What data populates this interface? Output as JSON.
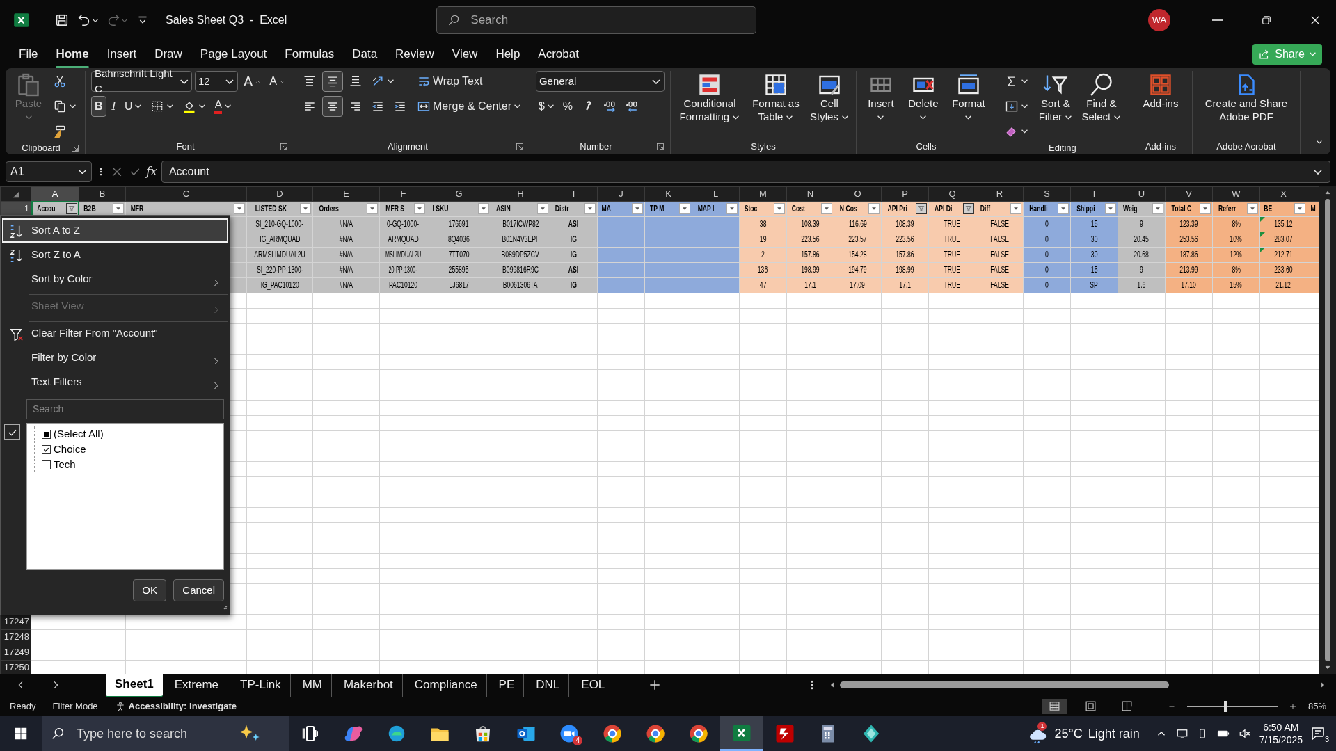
{
  "title_bar": {
    "title": "Sales Sheet Q3  -  Excel",
    "search_placeholder": "Search",
    "avatar": "WA",
    "quick_access": [
      {
        "kind": "save",
        "disabled": false
      },
      {
        "kind": "undo",
        "disabled": false
      },
      {
        "kind": "redo",
        "disabled": true
      },
      {
        "kind": "customize",
        "disabled": false
      }
    ]
  },
  "menu_tabs": [
    {
      "label": "File",
      "selected": false
    },
    {
      "label": "Home",
      "selected": true
    },
    {
      "label": "Insert",
      "selected": false
    },
    {
      "label": "Draw",
      "selected": false
    },
    {
      "label": "Page Layout",
      "selected": false
    },
    {
      "label": "Formulas",
      "selected": false
    },
    {
      "label": "Data",
      "selected": false
    },
    {
      "label": "Review",
      "selected": false
    },
    {
      "label": "View",
      "selected": false
    },
    {
      "label": "Help",
      "selected": false
    },
    {
      "label": "Acrobat",
      "selected": false
    }
  ],
  "share_button": "Share",
  "ribbon": {
    "groups": [
      {
        "label": "Clipboard",
        "launcher": true,
        "controls": [
          {
            "kind": "paste",
            "label": "Paste",
            "dropdown": true,
            "disabled": true
          },
          {
            "kind": "stack",
            "items": [
              {
                "kind": "cut"
              },
              {
                "kind": "copy",
                "dropdown": true
              },
              {
                "kind": "painter"
              }
            ]
          }
        ]
      },
      {
        "label": "Font",
        "launcher": true,
        "controls": [
          {
            "kind": "stack",
            "items": [
              {
                "kind": "row",
                "items": [
                  {
                    "kind": "font-name",
                    "value": "Bahnschrift Light C"
                  },
                  {
                    "kind": "font-size",
                    "value": "12"
                  },
                  {
                    "kind": "grow",
                    "label": "A"
                  },
                  {
                    "kind": "shrink",
                    "label": "A"
                  }
                ]
              },
              {
                "kind": "row",
                "items": [
                  {
                    "kind": "bold",
                    "label": "B",
                    "selected": true
                  },
                  {
                    "kind": "italic",
                    "label": "I",
                    "selected": false
                  },
                  {
                    "kind": "underline",
                    "label": "U",
                    "selected": false,
                    "dropdown": true
                  },
                  {
                    "kind": "borders",
                    "dropdown": true
                  },
                  {
                    "kind": "fill",
                    "dropdown": true
                  },
                  {
                    "kind": "font-color",
                    "label": "A",
                    "dropdown": true
                  }
                ]
              }
            ]
          }
        ]
      },
      {
        "label": "Alignment",
        "launcher": true,
        "controls": [
          {
            "kind": "stack",
            "items": [
              {
                "kind": "row",
                "items": [
                  {
                    "kind": "align-top",
                    "selected": false
                  },
                  {
                    "kind": "align-middle",
                    "selected": true
                  },
                  {
                    "kind": "align-bottom",
                    "selected": false
                  },
                  {
                    "kind": "orientation",
                    "dropdown": true
                  }
                ]
              },
              {
                "kind": "row",
                "items": [
                  {
                    "kind": "align-left",
                    "selected": false
                  },
                  {
                    "kind": "align-center",
                    "selected": true
                  },
                  {
                    "kind": "align-right",
                    "selected": false
                  },
                  {
                    "kind": "outdent"
                  },
                  {
                    "kind": "indent"
                  }
                ]
              }
            ]
          },
          {
            "kind": "stack",
            "items": [
              {
                "kind": "wrap",
                "label": "Wrap Text"
              },
              {
                "kind": "merge",
                "label": "Merge & Center",
                "dropdown": true
              }
            ]
          }
        ]
      },
      {
        "label": "Number",
        "launcher": true,
        "controls": [
          {
            "kind": "stack",
            "items": [
              {
                "kind": "number-format",
                "value": "General"
              },
              {
                "kind": "row",
                "items": [
                  {
                    "kind": "currency",
                    "label": "$",
                    "dropdown": true
                  },
                  {
                    "kind": "percent",
                    "label": "%"
                  },
                  {
                    "kind": "comma"
                  },
                  {
                    "kind": "inc-decimal"
                  },
                  {
                    "kind": "dec-decimal"
                  }
                ]
              }
            ]
          }
        ]
      },
      {
        "label": "Styles",
        "launcher": false,
        "controls": [
          {
            "kind": "conditional",
            "label": "Conditional Formatting",
            "dropdown": true
          },
          {
            "kind": "format-table",
            "label": "Format as Table",
            "dropdown": true
          },
          {
            "kind": "cell-styles",
            "label": "Cell Styles",
            "dropdown": true
          }
        ]
      },
      {
        "label": "Cells",
        "launcher": false,
        "controls": [
          {
            "kind": "insert",
            "label": "Insert",
            "dropdown": true
          },
          {
            "kind": "delete",
            "label": "Delete",
            "dropdown": true
          },
          {
            "kind": "format",
            "label": "Format",
            "dropdown": true
          }
        ]
      },
      {
        "label": "Editing",
        "launcher": false,
        "controls": [
          {
            "kind": "stack",
            "items": [
              {
                "kind": "sum",
                "dropdown": true
              },
              {
                "kind": "fill-down",
                "dropdown": true
              },
              {
                "kind": "clear",
                "dropdown": true
              }
            ]
          },
          {
            "kind": "sort-filter",
            "label": "Sort & Filter",
            "dropdown": true
          },
          {
            "kind": "find",
            "label": "Find & Select",
            "dropdown": true
          }
        ]
      },
      {
        "label": "Add-ins",
        "launcher": false,
        "controls": [
          {
            "kind": "addins",
            "label": "Add-ins",
            "dropdown": false
          }
        ]
      },
      {
        "label": "Adobe Acrobat",
        "launcher": false,
        "controls": [
          {
            "kind": "acrobat",
            "label": "Create and Share Adobe PDF",
            "dropdown": false
          }
        ]
      }
    ]
  },
  "formula_bar": {
    "name_box": "A1",
    "function_label": "fx",
    "formula": "Account"
  },
  "table": {
    "header_row": {
      "number": "1",
      "selected": true
    },
    "columns": [
      {
        "letter": "A",
        "header": "Accou",
        "filtered": true,
        "color": "#bfbfbf",
        "selected": true
      },
      {
        "letter": "B",
        "header": "B2B",
        "filtered": false,
        "color": "#bfbfbf",
        "selected": false
      },
      {
        "letter": "C",
        "header": "MFR",
        "filtered": false,
        "color": "#bfbfbf",
        "selected": false
      },
      {
        "letter": "D",
        "header": "LISTED SK",
        "filtered": false,
        "color": "#bfbfbf",
        "bold": false,
        "selected": false
      },
      {
        "letter": "E",
        "header": "Orders",
        "filtered": false,
        "color": "#bfbfbf",
        "bold": false,
        "selected": false
      },
      {
        "letter": "F",
        "header": "MFR S",
        "filtered": false,
        "color": "#bfbfbf",
        "bold": false,
        "selected": false
      },
      {
        "letter": "G",
        "header": "I SKU",
        "filtered": false,
        "color": "#bfbfbf",
        "bold": false,
        "selected": false
      },
      {
        "letter": "H",
        "header": "ASIN",
        "filtered": false,
        "color": "#bfbfbf",
        "bold": false,
        "selected": false
      },
      {
        "letter": "I",
        "header": "Distr",
        "filtered": false,
        "color": "#bfbfbf",
        "bold": true,
        "selected": false
      },
      {
        "letter": "J",
        "header": "MA",
        "filtered": false,
        "color": "#8eaadb",
        "selected": false
      },
      {
        "letter": "K",
        "header": "TP M",
        "filtered": false,
        "color": "#8eaadb",
        "selected": false
      },
      {
        "letter": "L",
        "header": "MAP I",
        "filtered": false,
        "color": "#8eaadb",
        "selected": false
      },
      {
        "letter": "M",
        "header": "Stoc",
        "filtered": false,
        "color": "#f8cbad",
        "bold": false,
        "selected": false
      },
      {
        "letter": "N",
        "header": "Cost",
        "filtered": false,
        "color": "#f8cbad",
        "bold": false,
        "selected": false
      },
      {
        "letter": "O",
        "header": "N Cos",
        "filtered": false,
        "color": "#f8cbad",
        "bold": false,
        "selected": false
      },
      {
        "letter": "P",
        "header": "API Pri",
        "filtered": true,
        "color": "#f8cbad",
        "bold": false,
        "selected": false
      },
      {
        "letter": "Q",
        "header": "API Di",
        "filtered": true,
        "color": "#f8cbad",
        "bold": false,
        "selected": false
      },
      {
        "letter": "R",
        "header": "Diff",
        "filtered": false,
        "color": "#f8cbad",
        "bold": false,
        "selected": false
      },
      {
        "letter": "S",
        "header": "Handli",
        "filtered": false,
        "color": "#8eaadb",
        "bold": false,
        "selected": false
      },
      {
        "letter": "T",
        "header": "Shippi",
        "filtered": false,
        "color": "#8eaadb",
        "bold": false,
        "selected": false
      },
      {
        "letter": "U",
        "header": "Weig",
        "filtered": false,
        "color": "#bfbfbf",
        "bold": false,
        "selected": false
      },
      {
        "letter": "V",
        "header": "Total C",
        "filtered": false,
        "color": "#f4b183",
        "bold": false,
        "selected": false
      },
      {
        "letter": "W",
        "header": "Referr",
        "filtered": false,
        "color": "#f4b183",
        "bold": false,
        "selected": false
      },
      {
        "letter": "X",
        "header": "BE",
        "filtered": false,
        "color": "#f4b183",
        "bold": false,
        "selected": false
      },
      {
        "header": "M",
        "color": "#f4b183",
        "selected": false
      }
    ],
    "rows": [
      {
        "left_cells": [
          "SI_210-GQ-1000-",
          "#N/A",
          "0-GQ-1000-",
          "176691",
          "B017ICWP82",
          "ASI"
        ],
        "right_cells": [
          "38",
          "108.39",
          "116.69",
          "108.39",
          "TRUE",
          "FALSE",
          "0",
          "15",
          "9",
          "123.39",
          "8%",
          "135.12"
        ],
        "flag": true
      },
      {
        "left_cells": [
          "IG_ARMQUAD",
          "#N/A",
          "ARMQUAD",
          "8Q4036",
          "B01N4V3EPF",
          "IG"
        ],
        "right_cells": [
          "19",
          "223.56",
          "223.57",
          "223.56",
          "TRUE",
          "FALSE",
          "0",
          "30",
          "20.45",
          "253.56",
          "10%",
          "283.07"
        ],
        "flag": true
      },
      {
        "left_cells": [
          "ARMSLIMDUAL2U",
          "#N/A",
          "MSLIMDUAL2U",
          "7TT070",
          "B089DP5ZCV",
          "IG"
        ],
        "right_cells": [
          "2",
          "157.86",
          "154.28",
          "157.86",
          "TRUE",
          "FALSE",
          "0",
          "30",
          "20.68",
          "187.86",
          "12%",
          "212.71"
        ],
        "flag": true
      },
      {
        "left_cells": [
          "SI_220-PP-1300-",
          "#N/A",
          "20-PP-1300-",
          "255895",
          "B099816R9C",
          "ASI"
        ],
        "right_cells": [
          "136",
          "198.99",
          "194.79",
          "198.99",
          "TRUE",
          "FALSE",
          "0",
          "15",
          "9",
          "213.99",
          "8%",
          "233.60"
        ],
        "flag": false
      },
      {
        "left_cells": [
          "IG_PAC10120",
          "#N/A",
          "PAC10120",
          "LJ6817",
          "B0061306TA",
          "IG"
        ],
        "right_cells": [
          "47",
          "17.1",
          "17.09",
          "17.1",
          "TRUE",
          "FALSE",
          "0",
          "SP",
          "1.6",
          "17.10",
          "15%",
          "21.12"
        ],
        "flag": false
      }
    ],
    "trailing_rows": [
      {
        "number": "17247"
      },
      {
        "number": "17248"
      },
      {
        "number": "17249"
      },
      {
        "number": "17250"
      }
    ]
  },
  "filter_menu": {
    "items": [
      {
        "label": "Sort A to Z",
        "kind": "sort-asc",
        "selected": true,
        "disabled": false,
        "submenu": false,
        "separator_before": false
      },
      {
        "label": "Sort Z to A",
        "kind": "sort-desc",
        "selected": false,
        "disabled": false,
        "submenu": false,
        "separator_before": false
      },
      {
        "label": "Sort by Color",
        "kind": "plain",
        "selected": false,
        "disabled": false,
        "submenu": true,
        "separator_before": false
      },
      {
        "label": "Sheet View",
        "kind": "plain",
        "selected": false,
        "disabled": true,
        "submenu": true,
        "separator_before": true
      },
      {
        "label": "Clear Filter From \"Account\"",
        "kind": "clear-filter",
        "selected": false,
        "disabled": false,
        "submenu": false,
        "separator_before": true
      },
      {
        "label": "Filter by Color",
        "kind": "plain",
        "selected": false,
        "disabled": false,
        "submenu": true,
        "separator_before": false
      },
      {
        "label": "Text Filters",
        "kind": "plain",
        "selected": false,
        "disabled": false,
        "submenu": true,
        "separator_before": false
      }
    ],
    "toggle_box": {
      "checked": true
    },
    "search_placeholder": "Search",
    "values": [
      {
        "label": "(Select All)",
        "checked": false,
        "indeterminate": true
      },
      {
        "label": "Choice",
        "checked": true
      },
      {
        "label": "Tech",
        "checked": false
      }
    ],
    "buttons": [
      "OK",
      "Cancel"
    ]
  },
  "sheet_tabs": [
    {
      "label": "Sheet1",
      "selected": true
    },
    {
      "label": "Extreme",
      "selected": false
    },
    {
      "label": "TP-Link",
      "selected": false
    },
    {
      "label": "MM",
      "selected": false
    },
    {
      "label": "Makerbot",
      "selected": false
    },
    {
      "label": "Compliance",
      "selected": false
    },
    {
      "label": "PE",
      "selected": false
    },
    {
      "label": "DNL",
      "selected": false
    },
    {
      "label": "EOL",
      "selected": false
    }
  ],
  "status_bar": {
    "texts": [
      "Ready",
      "Filter Mode"
    ],
    "accessibility": "Accessibility: Investigate",
    "views": [
      {
        "kind": "normal",
        "selected": true
      },
      {
        "kind": "page-layout",
        "selected": false
      },
      {
        "kind": "page-break",
        "selected": false
      }
    ],
    "zoom": {
      "level": 0.42,
      "text": "85%"
    }
  },
  "taskbar": {
    "search_placeholder": "Type here to search",
    "apps": [
      {
        "kind": "task-view",
        "active": false
      },
      {
        "kind": "copilot",
        "active": false
      },
      {
        "kind": "edge",
        "active": false
      },
      {
        "kind": "explorer",
        "active": false
      },
      {
        "kind": "store",
        "active": false
      },
      {
        "kind": "outlook",
        "active": false
      },
      {
        "kind": "zoom",
        "active": false,
        "badge": "4"
      },
      {
        "kind": "chrome",
        "active": false
      },
      {
        "kind": "chrome",
        "active": false
      },
      {
        "kind": "chrome",
        "active": false
      },
      {
        "kind": "excel",
        "active": true
      },
      {
        "kind": "filezilla",
        "active": false
      },
      {
        "kind": "calculator",
        "active": false
      },
      {
        "kind": "diamond",
        "active": false
      }
    ],
    "weather": {
      "badge": "1",
      "temperature": "25°C",
      "condition": "Light rain"
    },
    "time": "6:50 AM",
    "date": "7/15/2025",
    "notifications": "3"
  }
}
